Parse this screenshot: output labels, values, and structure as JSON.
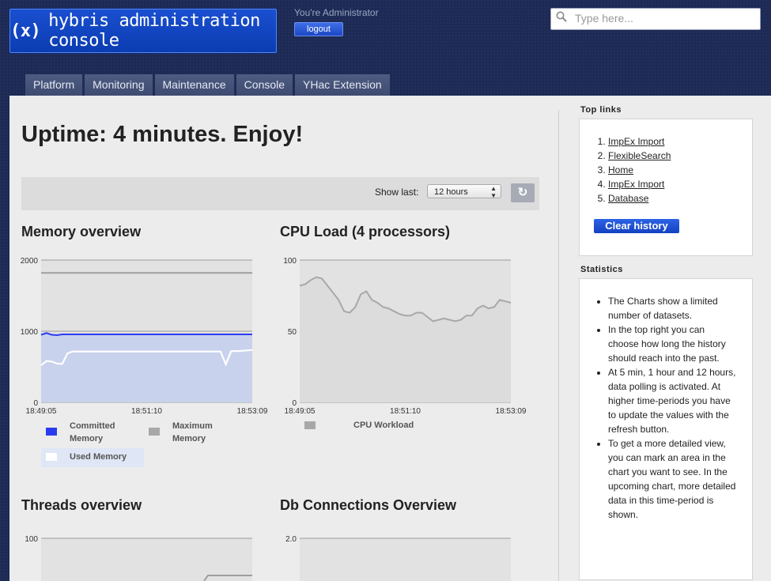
{
  "header": {
    "logo_text": "hybris administration console",
    "logo_mark": "(x)",
    "user_text": "You're Administrator",
    "logout_label": "logout",
    "search_placeholder": "Type here..."
  },
  "tabs": [
    "Platform",
    "Monitoring",
    "Maintenance",
    "Console",
    "YHac Extension"
  ],
  "main": {
    "uptime": "Uptime: 4 minutes. Enjoy!",
    "show_last_label": "Show last:",
    "show_last_value": "12 hours",
    "refresh_icon": "refresh-icon"
  },
  "charts": {
    "memory_title": "Memory overview",
    "cpu_title": "CPU Load (4 processors)",
    "threads_title": "Threads overview",
    "db_title": "Db Connections Overview",
    "legend_committed": "Committed Memory",
    "legend_maximum": "Maximum Memory",
    "legend_used": "Used Memory",
    "legend_cpu": "CPU Workload"
  },
  "chart_data": [
    {
      "type": "area",
      "title": "Memory overview",
      "x_ticks": [
        "18:49:05",
        "18:51:10",
        "18:53:09"
      ],
      "y_ticks": [
        0,
        1000,
        2000
      ],
      "ylim": [
        0,
        2000
      ],
      "series": [
        {
          "name": "Maximum Memory",
          "color": "#9e9e9e",
          "values": [
            1820,
            1820,
            1820,
            1820,
            1820,
            1820,
            1820,
            1820,
            1820,
            1820,
            1820,
            1820,
            1820,
            1820,
            1820,
            1820,
            1820,
            1820,
            1820,
            1820,
            1820,
            1820,
            1820,
            1820,
            1820,
            1820,
            1820,
            1820,
            1820,
            1820,
            1820,
            1820,
            1820,
            1820,
            1820,
            1820,
            1820,
            1820,
            1820,
            1820,
            1820
          ]
        },
        {
          "name": "Committed Memory",
          "color": "#2b3cf0",
          "values": [
            950,
            975,
            950,
            945,
            955,
            955,
            955,
            955,
            955,
            955,
            955,
            955,
            955,
            955,
            955,
            955,
            955,
            955,
            955,
            955,
            955,
            955,
            955,
            955,
            955,
            955,
            955,
            955,
            955,
            955,
            955,
            955,
            955,
            955,
            955,
            955,
            955,
            955,
            955,
            955,
            955
          ]
        },
        {
          "name": "Used Memory",
          "color": "#ffffff",
          "values": [
            520,
            580,
            575,
            545,
            540,
            690,
            715,
            715,
            715,
            715,
            715,
            715,
            715,
            715,
            715,
            715,
            715,
            715,
            715,
            715,
            715,
            715,
            715,
            715,
            715,
            715,
            715,
            715,
            715,
            715,
            715,
            715,
            715,
            715,
            715,
            535,
            720,
            720,
            725,
            730,
            735
          ]
        }
      ]
    },
    {
      "type": "area",
      "title": "CPU Load (4 processors)",
      "x_ticks": [
        "18:49:05",
        "18:51:10",
        "18:53:09"
      ],
      "y_ticks": [
        0,
        50,
        100
      ],
      "ylim": [
        0,
        100
      ],
      "series": [
        {
          "name": "CPU Workload",
          "color": "#a8a8a8",
          "values": [
            82,
            83,
            86,
            88,
            87,
            82,
            77,
            72,
            64,
            63,
            67,
            76,
            78,
            72,
            70,
            67,
            66,
            64,
            62,
            61,
            61,
            63,
            63,
            60,
            57,
            58,
            59,
            58,
            57,
            58,
            61,
            61,
            66,
            68,
            66,
            67,
            72,
            71,
            70
          ]
        }
      ]
    },
    {
      "type": "line",
      "title": "Threads overview",
      "y_ticks": [
        100
      ],
      "series": []
    },
    {
      "type": "line",
      "title": "Db Connections Overview",
      "y_ticks": [
        "2.0"
      ],
      "series": []
    }
  ],
  "sidebar": {
    "top_links_title": "Top links",
    "links": [
      "ImpEx Import",
      "FlexibleSearch",
      "Home",
      "ImpEx Import",
      "Database"
    ],
    "clear_history": "Clear history",
    "statistics_title": "Statistics",
    "stats": [
      "The Charts show a limited number of datasets.",
      "In the top right you can choose how long the history should reach into the past.",
      "At 5 min, 1 hour and 12 hours, data polling is activated. At higher time-periods you have to update the values with the refresh button.",
      "To get a more detailed view, you can mark an area in the chart you want to see. In the upcoming chart, more detailed data in this time-period is shown."
    ]
  }
}
